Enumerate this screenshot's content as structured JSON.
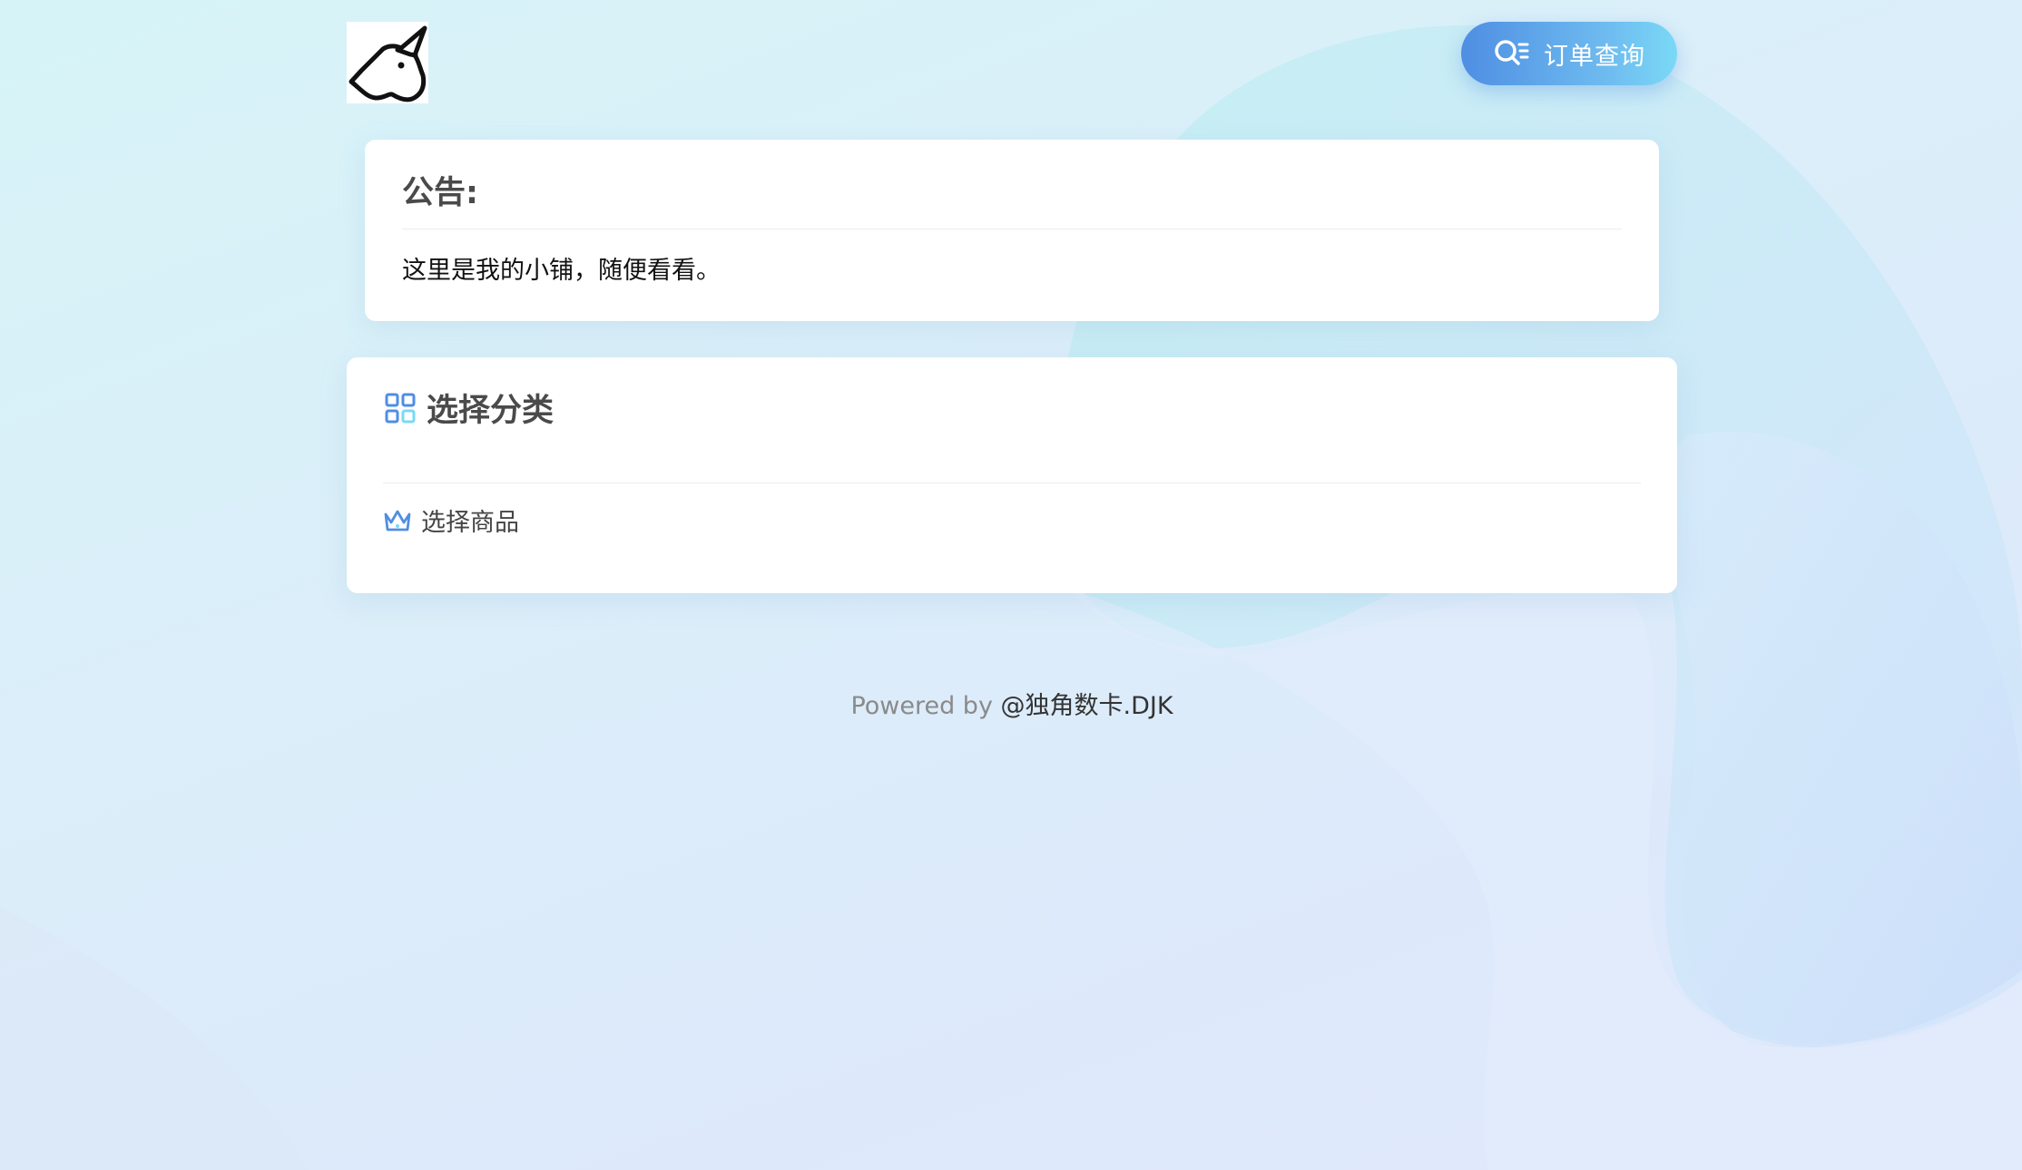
{
  "header": {
    "logo_icon": "unicorn-logo-icon",
    "query_button": {
      "label": "订单查询",
      "icon": "search-list-icon"
    }
  },
  "notice": {
    "title": "公告:",
    "text": "这里是我的小铺，随便看看。"
  },
  "category": {
    "title": "选择分类",
    "icon": "category-grid-icon",
    "item": {
      "label": "选择商品",
      "icon": "crown-icon"
    }
  },
  "footer": {
    "prefix": "Powered by ",
    "link": "@独角数卡.DJK"
  },
  "colors": {
    "accent_start": "#4f8ee3",
    "accent_end": "#7ad9f6",
    "card_bg": "#ffffff",
    "heading_text": "#4a4a4a"
  }
}
